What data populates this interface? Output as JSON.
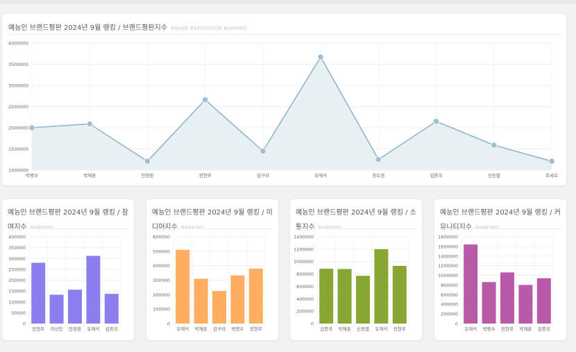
{
  "main": {
    "title": "예능인 브랜드평판 2024년 9월 랭킹 / 브랜드평판지수",
    "subtitle": "BRAND REPUTATION RANKING"
  },
  "cards": [
    {
      "title": "예능인 브랜드평판 2024년 9월 랭킹 / 참여지수",
      "subtitle": "RANKING"
    },
    {
      "title": "예능인 브랜드평판 2024년 9월 랭킹 / 미디어지수",
      "subtitle": "RANKING"
    },
    {
      "title": "예능인 브랜드평판 2024년 9월 랭킹 / 소통지수",
      "subtitle": "RANKING"
    },
    {
      "title": "예능인 브랜드평판 2024년 9월 랭킹 / 커뮤니티지수",
      "subtitle": "RANKING"
    }
  ],
  "chart_data": [
    {
      "type": "area",
      "categories": [
        "박명수",
        "박재훈",
        "안정환",
        "전현무",
        "김구라",
        "유재석",
        "장도연",
        "김종국",
        "신동엽",
        "조세호"
      ],
      "values": [
        2000000,
        2090000,
        1210000,
        2660000,
        1450000,
        3670000,
        1250000,
        2150000,
        1590000,
        1210000
      ],
      "ylim": [
        1000000,
        4000000
      ],
      "yticks": [
        "1000000",
        "1500000",
        "2000000",
        "2500000",
        "3000000",
        "3500000",
        "4000000"
      ],
      "color": "#8fb6cc",
      "fill": "#e8f0f4",
      "grid": true
    },
    {
      "type": "bar",
      "categories": [
        "전현무",
        "이상민",
        "안정환",
        "유재석",
        "김종국"
      ],
      "values": [
        280000,
        133000,
        156000,
        312000,
        137000
      ],
      "ylim": [
        0,
        400000
      ],
      "yticks": [
        "0",
        "50000",
        "100000",
        "150000",
        "200000",
        "250000",
        "300000",
        "350000",
        "400000"
      ],
      "color": "#8b7ff0",
      "grid": true
    },
    {
      "type": "bar",
      "categories": [
        "유재석",
        "박재훈",
        "김구라",
        "박명수",
        "전현무"
      ],
      "values": [
        510000,
        310000,
        225000,
        333000,
        380000
      ],
      "ylim": [
        0,
        600000
      ],
      "yticks": [
        "0",
        "100000",
        "200000",
        "300000",
        "400000",
        "500000",
        "600000"
      ],
      "color": "#ffad5e",
      "grid": true
    },
    {
      "type": "bar",
      "categories": [
        "김종국",
        "박재훈",
        "신동엽",
        "유재석",
        "전현무"
      ],
      "values": [
        885000,
        880000,
        770000,
        1200000,
        930000
      ],
      "ylim": [
        0,
        1400000
      ],
      "yticks": [
        "0",
        "200000",
        "400000",
        "600000",
        "800000",
        "1000000",
        "1200000",
        "1400000"
      ],
      "color": "#87a732",
      "grid": true
    },
    {
      "type": "bar",
      "categories": [
        "유재석",
        "박명수",
        "전현무",
        "박재훈",
        "김종국"
      ],
      "values": [
        1640000,
        860000,
        1060000,
        800000,
        940000
      ],
      "ylim": [
        0,
        1800000
      ],
      "yticks": [
        "0",
        "200000",
        "400000",
        "600000",
        "800000",
        "1000000",
        "1200000",
        "1400000",
        "1600000",
        "1800000"
      ],
      "color": "#b85aa8",
      "grid": true
    }
  ]
}
